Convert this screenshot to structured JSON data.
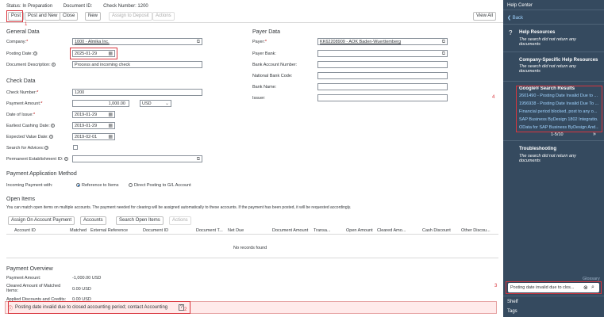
{
  "status": {
    "status": "Status: In Preparation",
    "doc_id": "Document ID:",
    "check_number": "Check Number: 1200"
  },
  "toolbar": {
    "post": "Post",
    "post_and_new": "Post and New",
    "close": "Close",
    "new": "New",
    "assign_to_deposit": "Assign to Deposit",
    "actions": "Actions",
    "view_all": "View All"
  },
  "markers": {
    "m1": "1",
    "m2": "2",
    "m3": "3",
    "m4": "4"
  },
  "general": {
    "title": "General Data",
    "company_label": "Company:",
    "company_value": "1000 - Almika Inc.",
    "posting_date_label": "Posting Date:",
    "posting_date_value": "2025-01-29",
    "doc_desc_label": "Document Description:",
    "doc_desc_value": "Process and incoming check"
  },
  "payer": {
    "title": "Payer Data",
    "payer_label": "Payer:",
    "payer_value": "KK62208909 - AOK Baden-Wuerttemberg",
    "payer_bank_label": "Payer Bank:",
    "bank_account_label": "Bank Account Number:",
    "national_bank_label": "National Bank Code:",
    "bank_name_label": "Bank Name:",
    "issuer_label": "Issuer:"
  },
  "check": {
    "title": "Check Data",
    "check_number_label": "Check Number:",
    "check_number_value": "1200",
    "payment_amount_label": "Payment Amount:",
    "payment_amount_value": "1,000.00",
    "currency": "USD",
    "date_issue_label": "Date of Issue:",
    "date_issue_value": "2019-01-29",
    "earliest_cashing_label": "Earliest Cashing Date:",
    "earliest_cashing_value": "2019-01-29",
    "expected_value_label": "Expected Value Date:",
    "expected_value_value": "2019-02-01",
    "search_advices_label": "Search for Advices:",
    "permanent_est_label": "Permanent Establishment ID:"
  },
  "payment_method": {
    "title": "Payment Application Method",
    "incoming_label": "Incoming Payment with:",
    "opt1": "Reference to Items",
    "opt2": "Direct Posting to G/L Account"
  },
  "open_items": {
    "title": "Open Items",
    "desc": "You can match open items on multiple accounts. The payment needed for clearing will be assigned automatically to these accounts. If the payment has been posted, it will be requested accordingly.",
    "btn_assign": "Assign On Account Payment",
    "btn_accounts": "Accounts",
    "btn_search": "Search Open Items",
    "btn_actions": "Actions",
    "columns": [
      "Account ID",
      "Matched",
      "External Reference",
      "Document ID",
      "Document T...",
      "Net Due",
      "Document Amount",
      "Transa...",
      "Open Amount",
      "Cleared Amo...",
      "Cash Discount",
      "Other Discou..."
    ],
    "empty": "No records found"
  },
  "overview": {
    "title": "Payment Overview",
    "payment_amount_label": "Payment Amount:",
    "payment_amount_value": "-1,000.00 USD",
    "cleared_label": "Cleared Amount of Matched Items:",
    "cleared_value": "0.00 USD",
    "applied_label": "Applied Discounts and Credits:",
    "applied_value": "0.00 USD"
  },
  "error": {
    "message": "Posting date invalid due to closed accounting period; contact Accounting"
  },
  "help": {
    "title": "Help Center",
    "back": "Back",
    "help_resources": "Help Resources",
    "no_docs1": "The search did not return any documents",
    "company_resources": "Company-Specific Help Resources",
    "no_docs2": "The search did not return any documents",
    "google_title": "Google® Search Results",
    "results": [
      "2601490 - Posting Date Invalid Due to ...",
      "1956938 - Posting Date Invalid Due To ...",
      "Financial period blocked, post to any o...",
      "SAP Business ByDesign 1802 Integratio...",
      "OData for SAP Business ByDesign And..."
    ],
    "pager": "1-5/10",
    "troubleshooting": "Troubleshooting",
    "no_docs3": "The search did not return any documents",
    "glossary": "Glossary",
    "search_value": "Posting date invalid due to clos...",
    "shelf": "Shelf",
    "tags": "Tags"
  }
}
